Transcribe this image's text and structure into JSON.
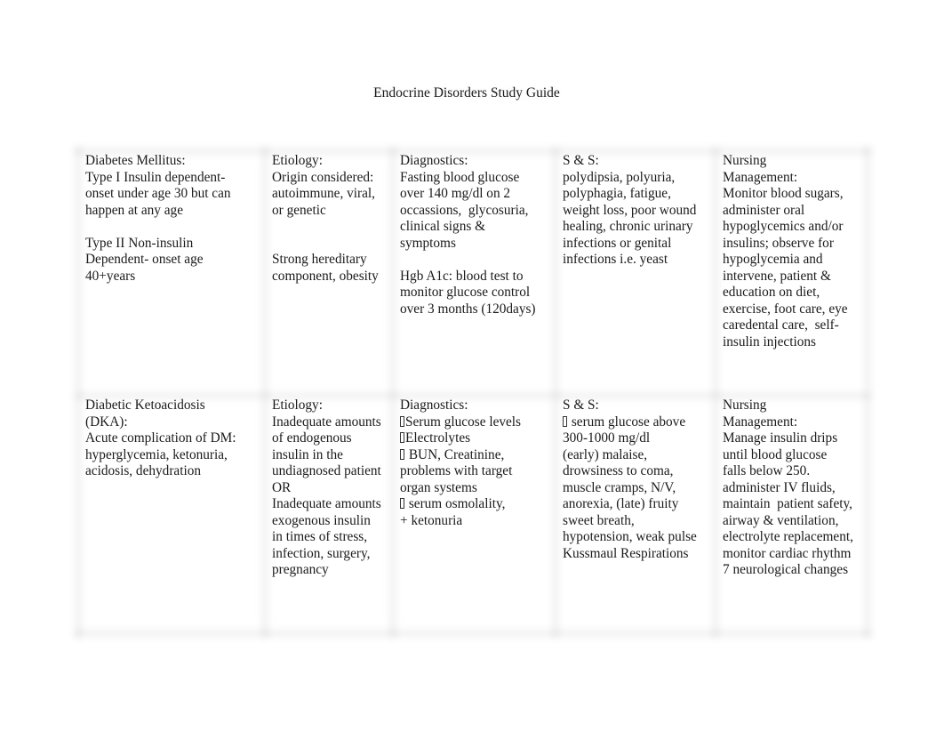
{
  "document": {
    "title": "Endocrine Disorders Study Guide"
  },
  "table": {
    "rows": [
      {
        "cells": [
          [
            "Diabetes Mellitus:",
            "Type I Insulin dependent-",
            "onset under age 30 but can",
            "happen at any age",
            "",
            "Type II Non-insulin",
            "Dependent- onset age",
            "40+years"
          ],
          [
            "Etiology:",
            "Origin considered:",
            "autoimmune, viral,",
            "or genetic",
            "",
            "",
            "Strong hereditary",
            "component, obesity"
          ],
          [
            "Diagnostics:",
            "Fasting blood glucose",
            "over 140 mg/dl on 2",
            "occassions,  glycosuria,",
            "clinical signs &",
            "symptoms",
            "",
            "Hgb A1c: blood test to",
            "monitor glucose control",
            "over 3 months (120days)"
          ],
          [
            "S & S:",
            "polydipsia, polyuria,",
            "polyphagia, fatigue,",
            "weight loss, poor wound",
            "healing, chronic urinary",
            "infections or genital",
            "infections i.e. yeast"
          ],
          [
            "Nursing",
            "Management:",
            "Monitor blood sugars,",
            "administer oral",
            "hypoglycemics and/or",
            "insulins; observe for",
            "hypoglycemia and",
            "intervene, patient &",
            "education on diet,",
            "exercise, foot care, eye",
            "caredental care,  self-",
            "insulin injections"
          ]
        ]
      },
      {
        "cells": [
          [
            "Diabetic Ketoacidosis",
            "(DKA):",
            "Acute complication of DM:",
            "hyperglycemia, ketonuria,",
            "acidosis, dehydration"
          ],
          [
            "Etiology:",
            "Inadequate amounts",
            "of endogenous",
            "insulin in the",
            "undiagnosed patient",
            "OR",
            "Inadequate amounts",
            "exogenous insulin",
            "in times of stress,",
            "infection, surgery,",
            "pregnancy"
          ],
          [
            "Diagnostics:",
            "[]Serum glucose levels",
            "[]Electrolytes",
            "[] BUN, Creatinine,",
            "problems with target",
            "organ systems",
            "[] serum osmolality,",
            "+ ketonuria"
          ],
          [
            "S & S:",
            "[] serum glucose above",
            "300-1000 mg/dl",
            "(early) malaise,",
            "drowsiness to coma,",
            "muscle cramps, N/V,",
            "anorexia, (late) fruity",
            "sweet breath,",
            "hypotension, weak pulse",
            "Kussmaul Respirations"
          ],
          [
            "Nursing",
            "Management:",
            "Manage insulin drips",
            "until blood glucose",
            "falls below 250.",
            "administer IV fluids,",
            "maintain  patient safety,",
            "airway & ventilation,",
            "electrolyte replacement,",
            "monitor cardiac rhythm",
            "7 neurological changes"
          ]
        ]
      }
    ],
    "missing_glyph_marker": "[]"
  }
}
